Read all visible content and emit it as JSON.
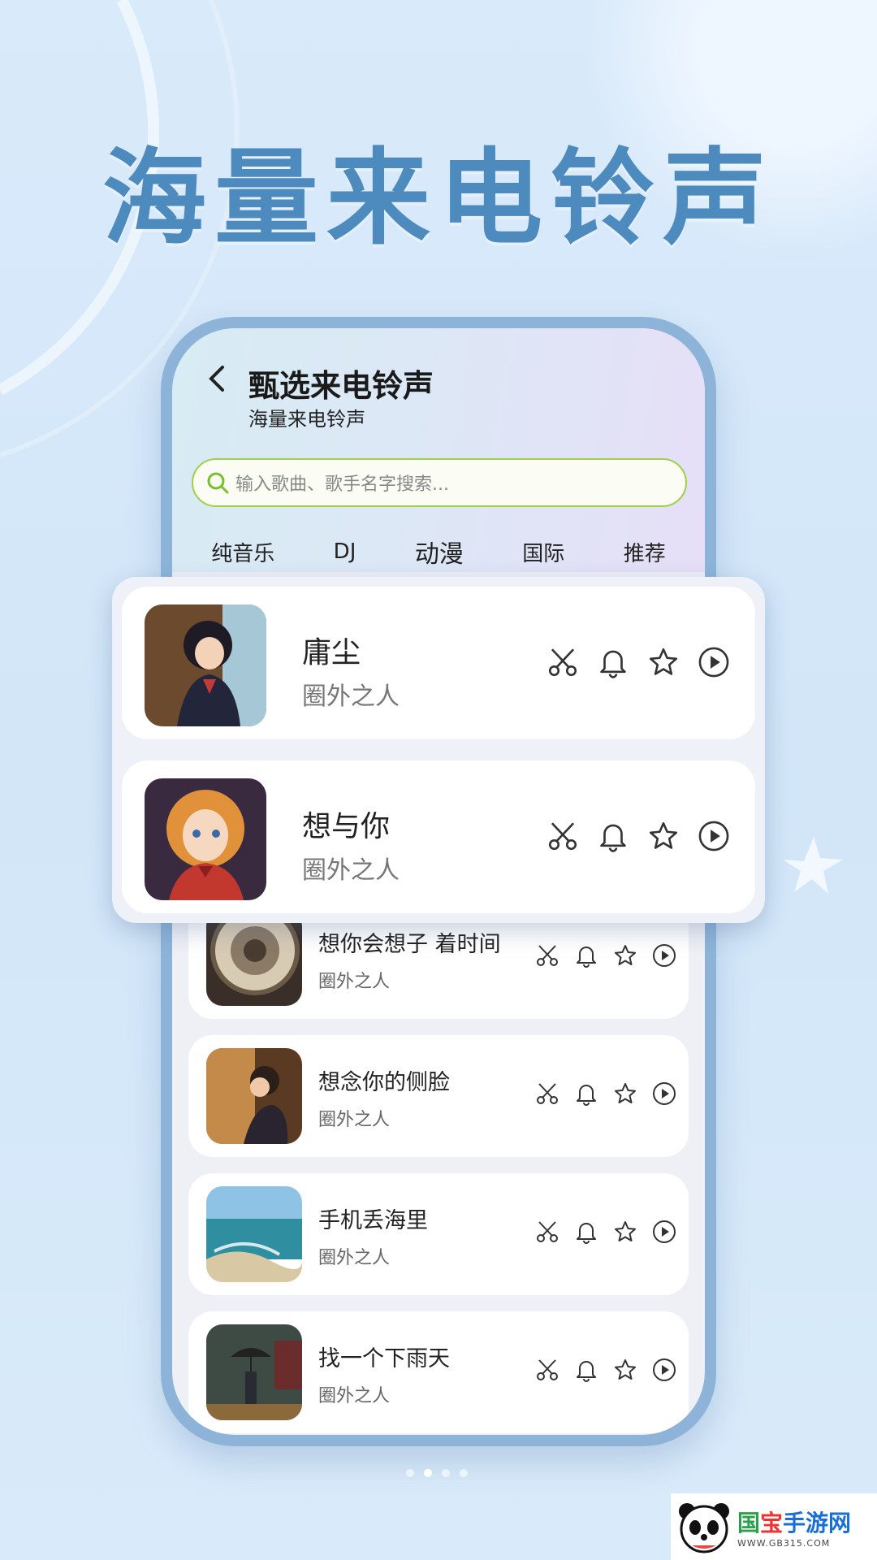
{
  "headline": "海量来电铃声",
  "screen": {
    "back_icon": "chevron-left-icon",
    "title": "甄选来电铃声",
    "subtitle": "海量来电铃声",
    "search": {
      "placeholder": "输入歌曲、歌手名字搜索..."
    },
    "tabs": [
      {
        "label": "纯音乐",
        "active": false
      },
      {
        "label": "DJ",
        "active": false
      },
      {
        "label": "动漫",
        "active": true
      },
      {
        "label": "国际",
        "active": false
      },
      {
        "label": "推荐",
        "active": false
      }
    ],
    "list": [
      {
        "title": "想你会想子 着时间",
        "artist": "圈外之人",
        "thumb": "clock"
      },
      {
        "title": "想念你的侧脸",
        "artist": "圈外之人",
        "thumb": "girl-window"
      },
      {
        "title": "手机丢海里",
        "artist": "圈外之人",
        "thumb": "sea"
      },
      {
        "title": "找一个下雨天",
        "artist": "圈外之人",
        "thumb": "rain"
      }
    ]
  },
  "highlight": [
    {
      "title": "庸尘",
      "artist": "圈外之人",
      "thumb": "anime-girl-dark"
    },
    {
      "title": "想与你",
      "artist": "圈外之人",
      "thumb": "anime-girl-orange"
    }
  ],
  "row_icons": [
    "scissors-icon",
    "bell-icon",
    "star-icon",
    "play-icon"
  ],
  "watermark": {
    "name_a": "国",
    "name_b": "宝",
    "name_c": "手游网",
    "url": "WWW.GB315.COM"
  },
  "colors": {
    "headline": "#4d8bbf",
    "accent_green": "#86d45c",
    "frame": "#8db4d8"
  }
}
